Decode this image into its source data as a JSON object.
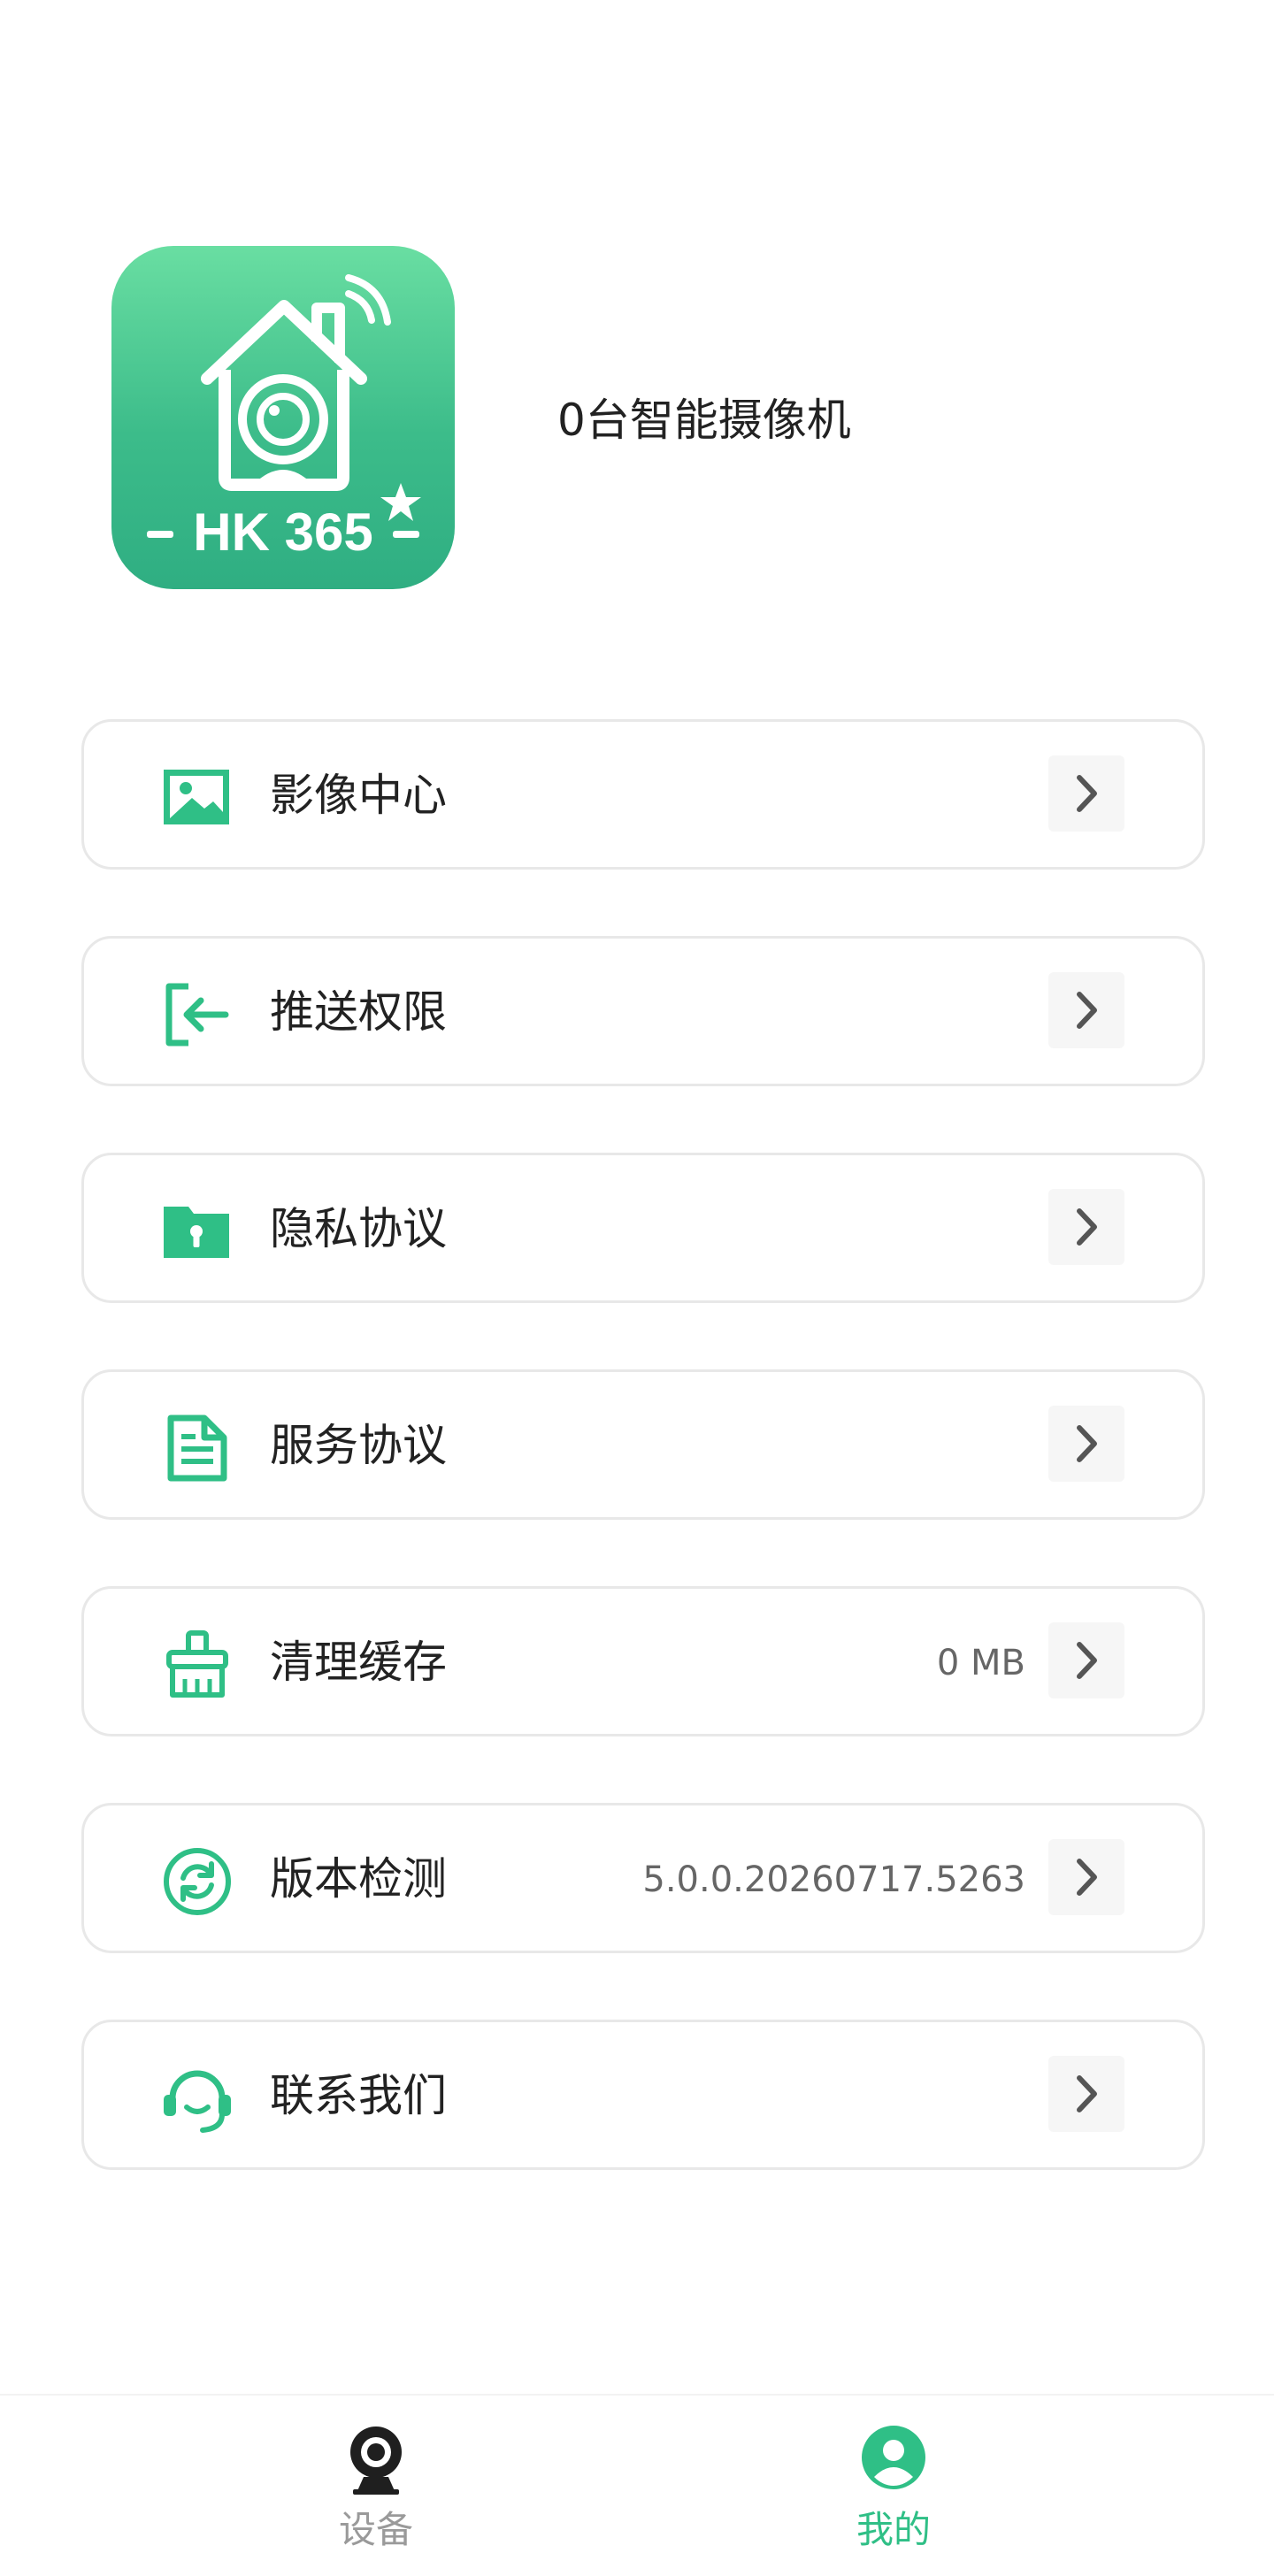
{
  "profile": {
    "logo_text": "HK 365",
    "device_count_text": "0台智能摄像机"
  },
  "menu": {
    "items": [
      {
        "label": "影像中心",
        "icon": "image-icon",
        "value": ""
      },
      {
        "label": "推送权限",
        "icon": "sign-in-icon",
        "value": ""
      },
      {
        "label": "隐私协议",
        "icon": "locked-folder-icon",
        "value": ""
      },
      {
        "label": "服务协议",
        "icon": "document-icon",
        "value": ""
      },
      {
        "label": "清理缓存",
        "icon": "broom-icon",
        "value": "0 MB"
      },
      {
        "label": "版本检测",
        "icon": "refresh-icon",
        "value": "5.0.0.20260717.5263"
      },
      {
        "label": "联系我们",
        "icon": "headset-icon",
        "value": ""
      }
    ]
  },
  "tabbar": {
    "tabs": [
      {
        "label": "设备",
        "icon": "camera-icon",
        "active": false
      },
      {
        "label": "我的",
        "icon": "user-icon",
        "active": true
      }
    ]
  },
  "colors": {
    "accent": "#2fbf86",
    "inactive": "#9a9a9a",
    "card_border": "#e8e8e8"
  }
}
